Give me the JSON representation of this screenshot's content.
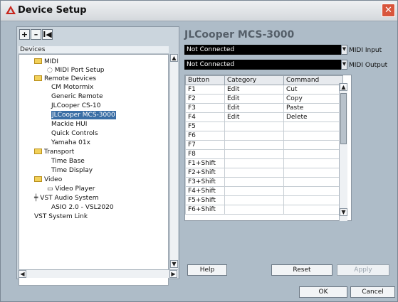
{
  "window": {
    "title": "Device Setup"
  },
  "toolbar": {
    "add": "+",
    "remove": "–",
    "reset": "I◀"
  },
  "tree": {
    "header": "Devices",
    "items": [
      "MIDI",
      "MIDI Port Setup",
      "Remote Devices",
      "CM Motormix",
      "Generic Remote",
      "JLCooper CS-10",
      "JLCooper MCS-3000",
      "Mackie HUI",
      "Quick Controls",
      "Yamaha 01x",
      "Transport",
      "Time Base",
      "Time Display",
      "Video",
      "Video Player",
      "VST Audio System",
      "ASIO 2.0 - VSL2020",
      "VST System Link"
    ]
  },
  "device": {
    "title": "JLCooper MCS-3000",
    "midi_input_value": "Not Connected",
    "midi_input_label": "MIDI Input",
    "midi_output_value": "Not Connected",
    "midi_output_label": "MIDI Output"
  },
  "table": {
    "headers": [
      "Button",
      "Category",
      "Command"
    ],
    "rows": [
      [
        "F1",
        "Edit",
        "Cut"
      ],
      [
        "F2",
        "Edit",
        "Copy"
      ],
      [
        "F3",
        "Edit",
        "Paste"
      ],
      [
        "F4",
        "Edit",
        "Delete"
      ],
      [
        "F5",
        "",
        ""
      ],
      [
        "F6",
        "",
        ""
      ],
      [
        "F7",
        "",
        ""
      ],
      [
        "F8",
        "",
        ""
      ],
      [
        "F1+Shift",
        "",
        ""
      ],
      [
        "F2+Shift",
        "",
        ""
      ],
      [
        "F3+Shift",
        "",
        ""
      ],
      [
        "F4+Shift",
        "",
        ""
      ],
      [
        "F5+Shift",
        "",
        ""
      ],
      [
        "F6+Shift",
        "",
        ""
      ]
    ]
  },
  "buttons": {
    "help": "Help",
    "reset": "Reset",
    "apply": "Apply",
    "ok": "OK",
    "cancel": "Cancel"
  },
  "icons": {
    "close": "✕",
    "scroll_up": "▲",
    "scroll_down": "▼",
    "scroll_left": "◀",
    "scroll_right": "▶",
    "dropdown": "▼"
  }
}
